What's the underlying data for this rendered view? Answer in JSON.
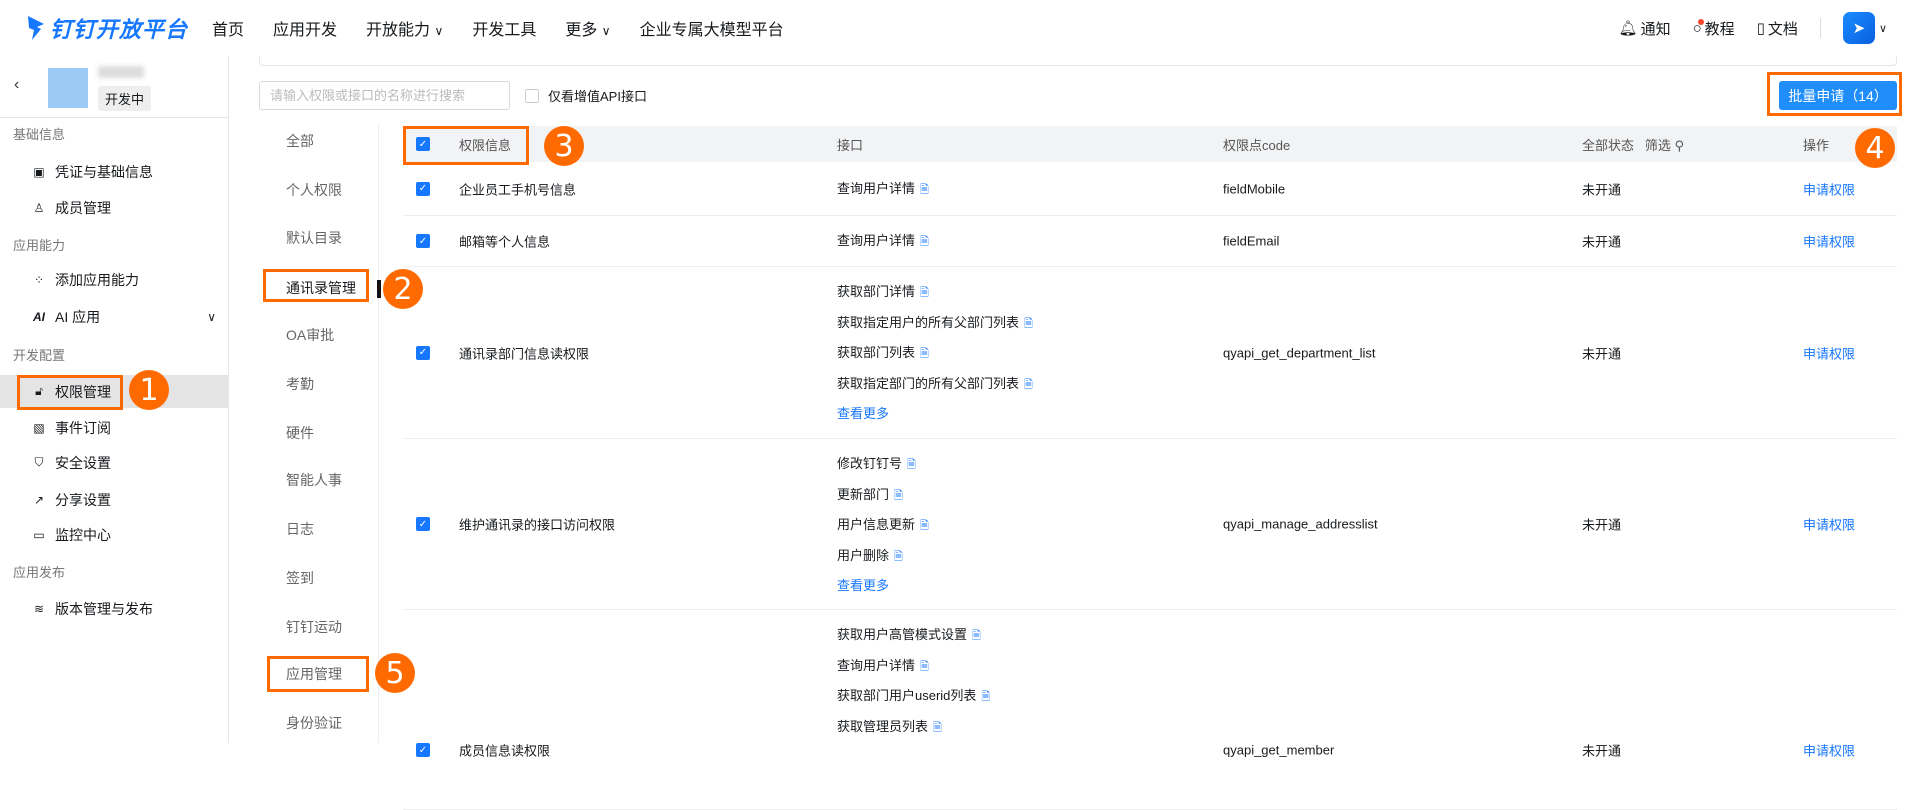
{
  "header": {
    "logo": "钉钉开放平台",
    "nav": [
      "首页",
      "应用开发",
      "开放能力",
      "开发工具",
      "更多",
      "企业专属大模型平台"
    ],
    "notify": "通知",
    "tutorial": "教程",
    "docs": "文档"
  },
  "sidebar": {
    "app_status": "开发中",
    "groups": [
      "基础信息",
      "应用能力",
      "开发配置",
      "应用发布"
    ],
    "items": [
      {
        "label": "凭证与基础信息"
      },
      {
        "label": "成员管理"
      },
      {
        "label": "添加应用能力"
      },
      {
        "label": "AI 应用"
      },
      {
        "label": "权限管理"
      },
      {
        "label": "事件订阅"
      },
      {
        "label": "安全设置"
      },
      {
        "label": "分享设置"
      },
      {
        "label": "监控中心"
      },
      {
        "label": "版本管理与发布"
      }
    ]
  },
  "toolbar": {
    "search_placeholder": "请输入权限或接口的名称进行搜索",
    "only_paid": "仅看增值API接口",
    "batch": "批量申请（14）"
  },
  "tabs": [
    "全部",
    "个人权限",
    "默认目录",
    "通讯录管理",
    "OA审批",
    "考勤",
    "硬件",
    "智能人事",
    "日志",
    "签到",
    "钉钉运动",
    "应用管理",
    "身份验证"
  ],
  "table": {
    "headers": {
      "perm": "权限信息",
      "api": "接口",
      "code": "权限点code",
      "status": "全部状态",
      "filter": "筛选",
      "op": "操作"
    },
    "rows": [
      {
        "perm": "企业员工手机号信息",
        "apis": [
          "查询用户详情"
        ],
        "more": "",
        "code": "fieldMobile",
        "status": "未开通",
        "op": "申请权限"
      },
      {
        "perm": "邮箱等个人信息",
        "apis": [
          "查询用户详情"
        ],
        "more": "",
        "code": "fieldEmail",
        "status": "未开通",
        "op": "申请权限"
      },
      {
        "perm": "通讯录部门信息读权限",
        "apis": [
          "获取部门详情",
          "获取指定用户的所有父部门列表",
          "获取部门列表",
          "获取指定部门的所有父部门列表"
        ],
        "more": "查看更多",
        "code": "qyapi_get_department_list",
        "status": "未开通",
        "op": "申请权限"
      },
      {
        "perm": "维护通讯录的接口访问权限",
        "apis": [
          "修改钉钉号",
          "更新部门",
          "用户信息更新",
          "用户删除"
        ],
        "more": "查看更多",
        "code": "qyapi_manage_addresslist",
        "status": "未开通",
        "op": "申请权限"
      },
      {
        "perm": "成员信息读权限",
        "apis": [
          "获取用户高管模式设置",
          "查询用户详情",
          "获取部门用户userid列表",
          "获取管理员列表"
        ],
        "more": "",
        "code": "qyapi_get_member",
        "status": "未开通",
        "op": "申请权限"
      }
    ]
  },
  "annotations": [
    "1",
    "2",
    "3",
    "4",
    "5"
  ]
}
